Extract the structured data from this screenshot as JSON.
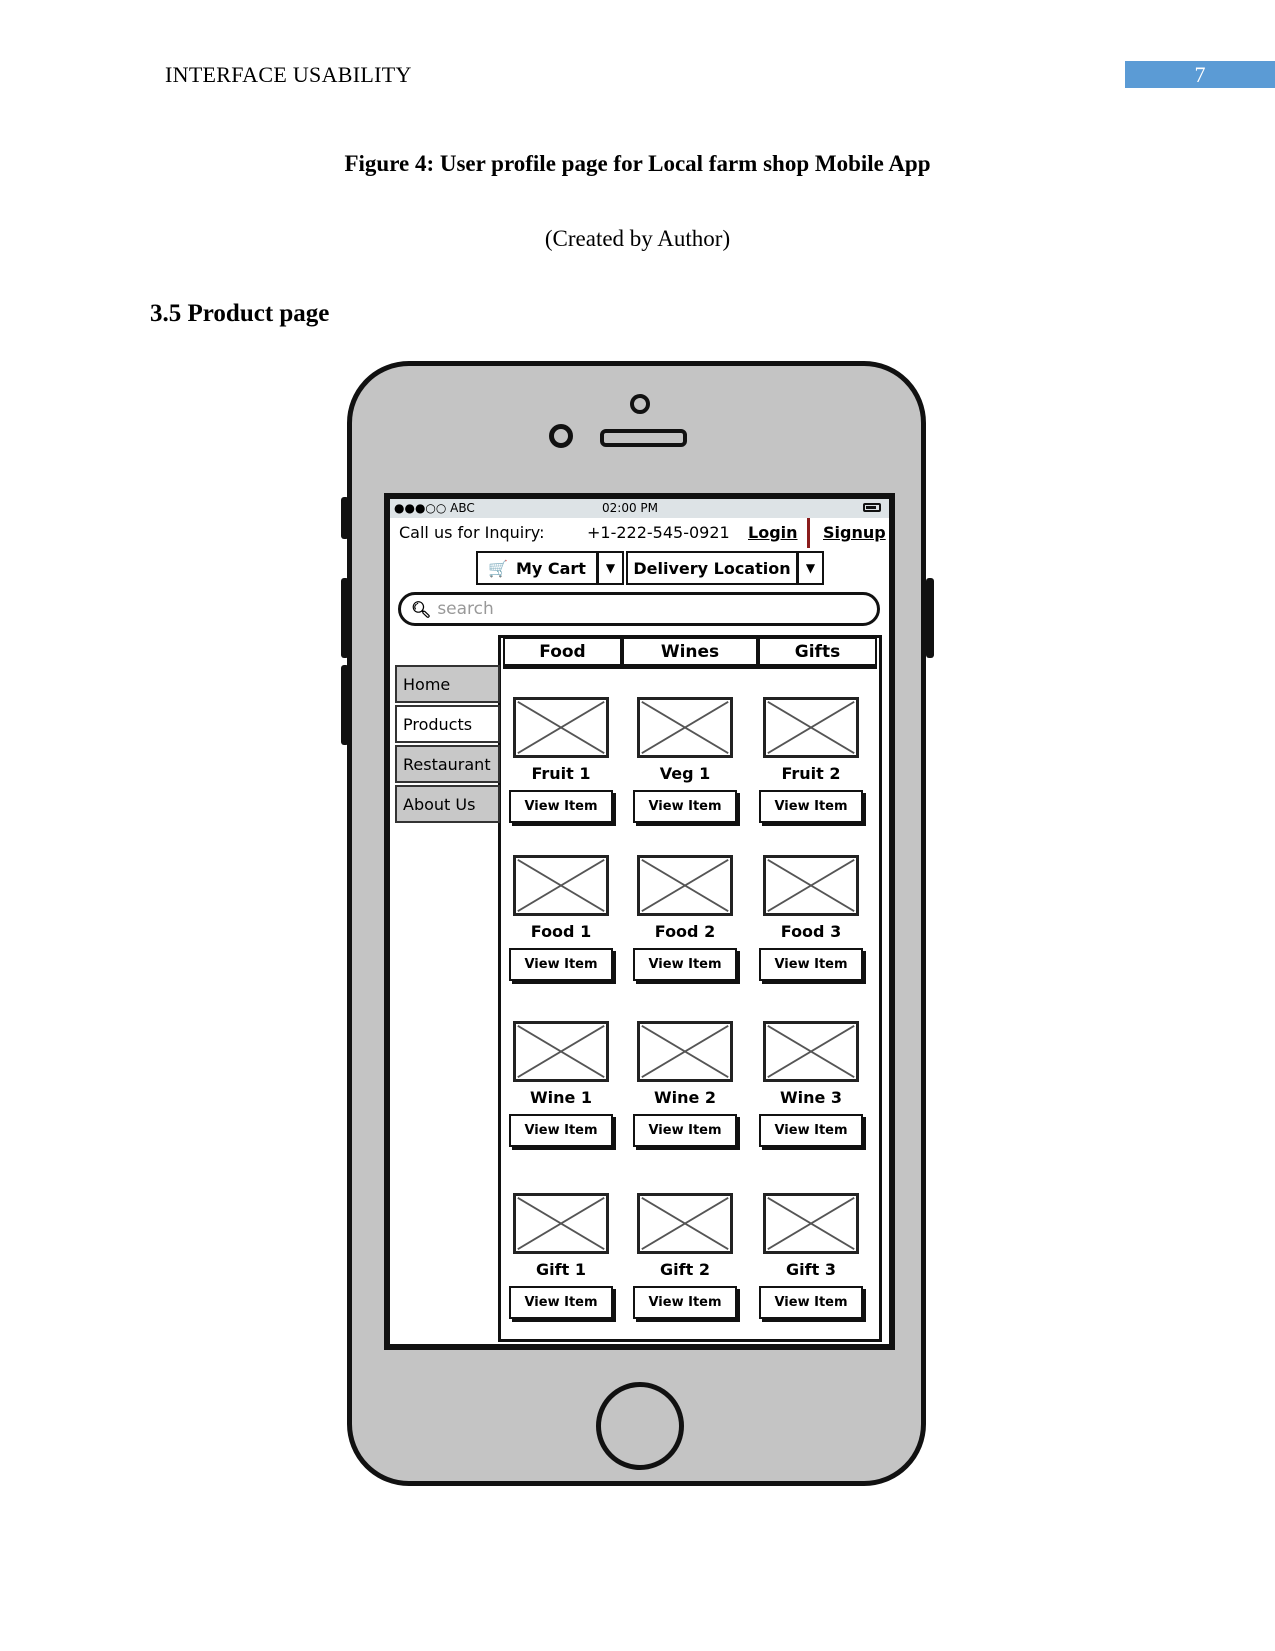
{
  "document": {
    "running_head": "INTERFACE USABILITY",
    "page_number": "7",
    "page_number_color": "#5b9bd5",
    "figure_caption": "Figure 4: User profile page for Local farm shop Mobile App",
    "figure_credit": "(Created by Author)",
    "section_heading": "3.5 Product page"
  },
  "wireframe": {
    "status_bar": {
      "signal": "●●●○○ ABC",
      "time": "02:00 PM",
      "battery_icon": "battery-icon"
    },
    "inquiry": {
      "label": "Call us for Inquiry:",
      "phone": "+1-222-545-0921",
      "login": "Login",
      "signup": "Signup"
    },
    "cart_button": "My Cart",
    "delivery_button": "Delivery Location",
    "search_placeholder": "search",
    "tabs": [
      "Food",
      "Wines",
      "Gifts"
    ],
    "nav": [
      {
        "label": "Home",
        "active": false
      },
      {
        "label": "Products",
        "active": true
      },
      {
        "label": "Restaurant",
        "active": false
      },
      {
        "label": "About Us",
        "active": false
      }
    ],
    "products": [
      [
        "Fruit 1",
        "Veg 1",
        "Fruit 2"
      ],
      [
        "Food 1",
        "Food 2",
        "Food 3"
      ],
      [
        "Wine 1",
        "Wine 2",
        "Wine 3"
      ],
      [
        "Gift 1",
        "Gift 2",
        "Gift 3"
      ]
    ],
    "view_item_label": "View Item"
  }
}
